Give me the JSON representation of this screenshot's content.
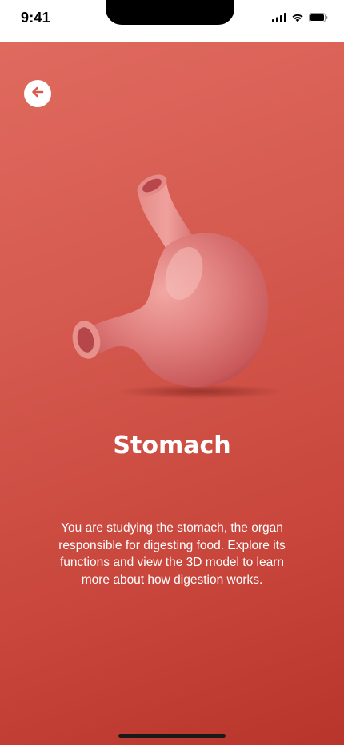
{
  "status_bar": {
    "time": "9:41",
    "icons": [
      "cellular-signal-icon",
      "wifi-icon",
      "battery-icon"
    ]
  },
  "header": {
    "back_icon": "arrow-left-icon"
  },
  "organ": {
    "image": "stomach-illustration"
  },
  "content": {
    "title": "Stomach",
    "description": "You are studying the stomach, the organ responsible for digesting food. Explore its functions and view the 3D model to learn more about how digestion works."
  },
  "colors": {
    "background_top": "#e06a5f",
    "background_bottom": "#b8352b",
    "organ": "#e07f7d",
    "text": "#ffffff"
  }
}
